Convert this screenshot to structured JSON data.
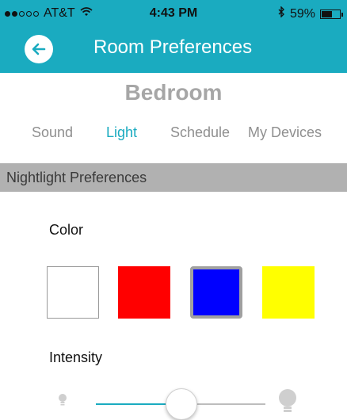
{
  "status_bar": {
    "carrier": "AT&T",
    "signal_bars": 2,
    "signal_total": 5,
    "time": "4:43 PM",
    "battery_percent": "59%",
    "battery_level": 0.59,
    "icons": [
      "wifi-icon",
      "bluetooth-icon",
      "battery-icon"
    ]
  },
  "nav": {
    "title": "Room Preferences",
    "back_icon": "arrow-left-icon"
  },
  "room": {
    "name": "Bedroom"
  },
  "tabs": [
    {
      "label": "Sound",
      "active": false
    },
    {
      "label": "Light",
      "active": true
    },
    {
      "label": "Schedule",
      "active": false
    },
    {
      "label": "My Devices",
      "active": false
    }
  ],
  "section": {
    "title": "Nightlight Preferences"
  },
  "color": {
    "label": "Color",
    "options": [
      {
        "name": "white",
        "hex": "#ffffff",
        "selected": false
      },
      {
        "name": "red",
        "hex": "#ff0000",
        "selected": false
      },
      {
        "name": "blue",
        "hex": "#0000ff",
        "selected": true
      },
      {
        "name": "yellow",
        "hex": "#ffff00",
        "selected": false
      }
    ]
  },
  "intensity": {
    "label": "Intensity",
    "value": 0.5,
    "min_icon": "bulb-small-icon",
    "max_icon": "bulb-large-icon"
  },
  "colors": {
    "accent": "#1aabc0",
    "section_bar": "#b1b1b1",
    "room_title": "#a6a6a6",
    "tab_inactive": "#8f8f8f"
  }
}
